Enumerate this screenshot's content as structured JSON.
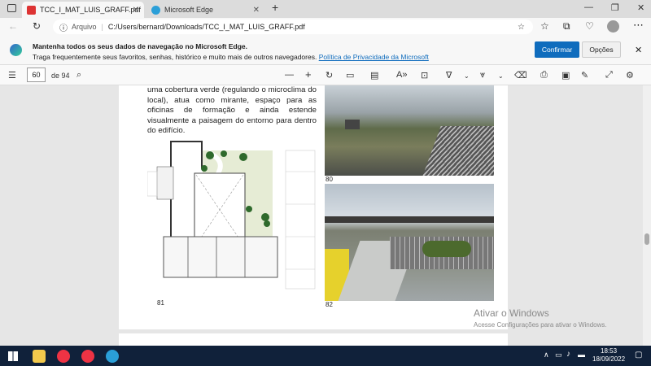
{
  "tabs": [
    {
      "label": "TCC_I_MAT_LUIS_GRAFF.pdf",
      "active": true
    },
    {
      "label": "Microsoft Edge",
      "active": false
    }
  ],
  "address": {
    "prefix": "Arquivo",
    "url": "C:/Users/bernard/Downloads/TCC_I_MAT_LUIS_GRAFF.pdf"
  },
  "infobar": {
    "title": "Mantenha todos os seus dados de navegação no Microsoft Edge.",
    "text": "Traga frequentemente seus favoritos, senhas, histórico e muito mais de outros navegadores.",
    "link": "Política de Privacidade da Microsoft",
    "confirm": "Confirmar",
    "options": "Opções"
  },
  "pdf": {
    "page": "60",
    "of": "de 94"
  },
  "content": {
    "paragraph": "uma cobertura verde (regulando o microclima do local), atua como mirante, espaço para as oficinas de formação e ainda estende visualmente a paisagem do entorno para dentro do edifício.",
    "fig80": "80",
    "fig81": "81",
    "fig82": "82"
  },
  "watermark": {
    "title": "Ativar o Windows",
    "sub": "Acesse Configurações para ativar o Windows."
  },
  "clock": {
    "time": "18:53",
    "date": "18/09/2022"
  }
}
